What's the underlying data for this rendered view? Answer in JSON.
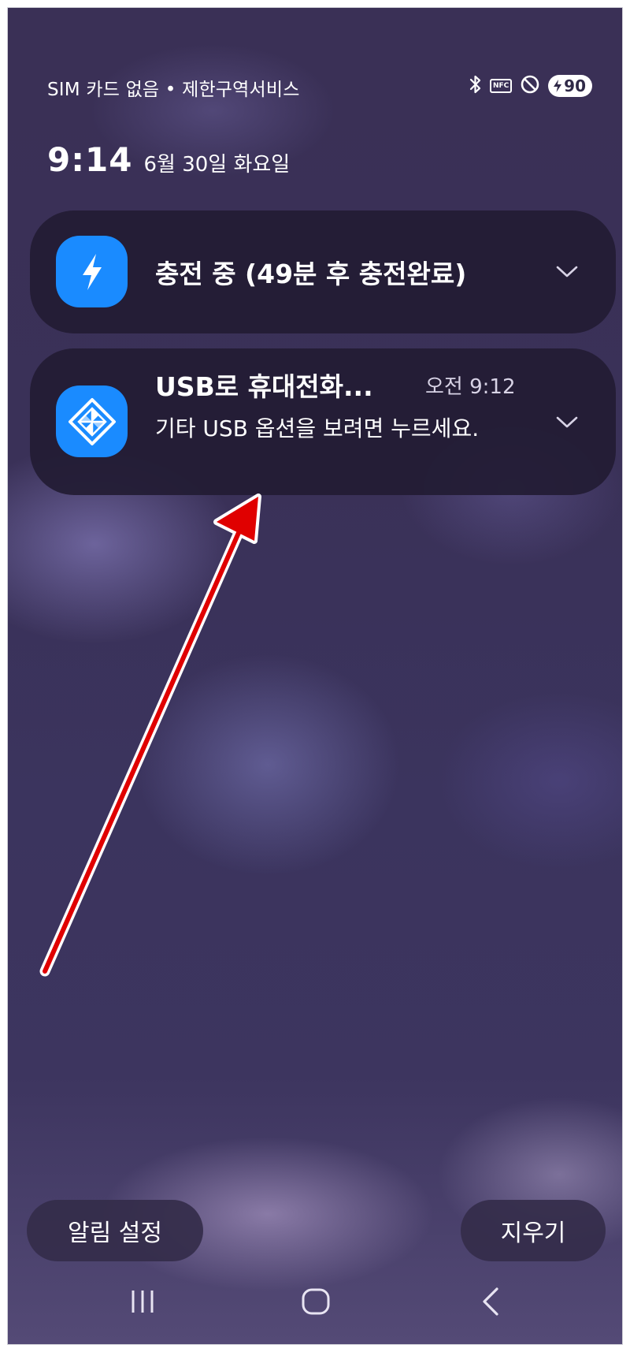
{
  "status_bar": {
    "carrier_text": "SIM 카드 없음 • 제한구역서비스",
    "nfc_label": "NFC",
    "battery_level": "90",
    "icons": [
      "bluetooth-icon",
      "nfc-icon",
      "do-not-disturb-icon",
      "battery-charging-icon"
    ]
  },
  "clock": {
    "time": "9:14",
    "date": "6월 30일 화요일"
  },
  "notifications": [
    {
      "icon": "lightning-bolt-icon",
      "title": "충전 중 (49분 후 충전완료)",
      "accent": "#1a8bff"
    },
    {
      "icon": "usb-diamond-icon",
      "title": "USB로 휴대전화...",
      "time": "오전 9:12",
      "body": "기타 USB 옵션을 보려면 누르세요.",
      "accent": "#1a8bff"
    }
  ],
  "actions": {
    "settings_label": "알림 설정",
    "clear_label": "지우기"
  },
  "navigation": {
    "icons": [
      "recent-apps-icon",
      "home-icon",
      "back-icon"
    ]
  },
  "annotation": {
    "arrow_color": "#e00000"
  }
}
